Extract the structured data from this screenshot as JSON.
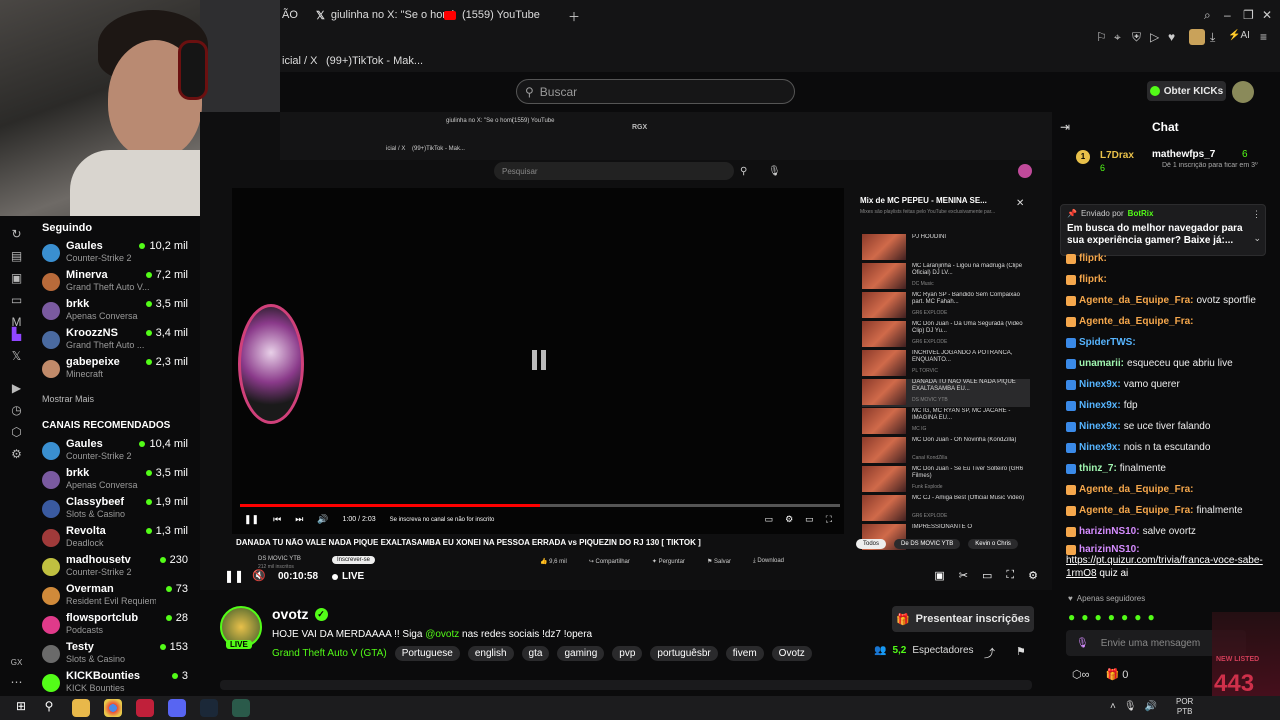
{
  "browser": {
    "tabs": [
      "ÃO",
      "giulinha no X: \"Se o homi",
      "(1559) YouTube"
    ],
    "tabs_row2": [
      "icial / X",
      "(99+)TikTok - Mak..."
    ],
    "search_placeholder": "Buscar",
    "kick_button": "Obter KICKs"
  },
  "inner_browser": {
    "tabs": [
      "giulinha no X: \"Se o homi",
      "(1559) YouTube"
    ],
    "tabs_row2": [
      "icial / X",
      "(99+)TikTok - Mak..."
    ],
    "yt_search_placeholder": "Pesquisar",
    "rgx_label": "RGX"
  },
  "youtube": {
    "mix_title": "Mix de MC PEPEU - MENINA SE...",
    "mix_subtitle": "Mixes são playlists feitas pelo YouTube exclusivamente par...",
    "playlist": [
      {
        "title": "PJ HOUDINI",
        "sub": "",
        "dur": ""
      },
      {
        "title": "MC Laranjinha - Ligou na madruga (Clipe Oficial) DJ LV...",
        "sub": "DC Music",
        "dur": "1:33"
      },
      {
        "title": "MC Ryan SP - Bandido Sem Compaixão part. MC Fahah...",
        "sub": "GR6 EXPLODE",
        "dur": "3:09"
      },
      {
        "title": "MC Don Juan - Da Uma Segurada (Video Clip) DJ Yu...",
        "sub": "GR6 EXPLODE",
        "dur": "2:38"
      },
      {
        "title": "INCRIVEL JOGANDO A POTRANCA, ENQUANTO...",
        "sub": "PL TORVIC",
        "dur": "1:47"
      },
      {
        "title": "DANADA TU NÃO VALE NADA PIQUE EXALTASAMBA EU...",
        "sub": "DS MOVIC YTB",
        "dur": "2:24"
      },
      {
        "title": "MC IG, MC RYAN SP, MC JACARÉ - IMAGINA EU...",
        "sub": "MC IG",
        "dur": "2:53"
      },
      {
        "title": "MC Don Juan - Ôh Novinha (KondZilla)",
        "sub": "Canal KondZilla",
        "dur": "2:55"
      },
      {
        "title": "MC Don Juan - Se Eu Tiver Solteiro (GR6 Filmes)",
        "sub": "Funk Explode",
        "dur": "3:06"
      },
      {
        "title": "MC CJ - Amiga Best (Official Music Video)",
        "sub": "GR6 EXPLODE",
        "dur": "2:20"
      },
      {
        "title": "IMPRESSIONANTE O",
        "sub": "",
        "dur": ""
      }
    ],
    "time": "1:00 / 2:03",
    "subscribe_hint": "Se inscreva no canal se não for inscrito",
    "video_title": "DANADA TU NÃO VALE NADA PIQUE EXALTASAMBA EU XONEI NA PESSOA ERRADA vs PIQUEZIN DO RJ 130 [ TIKTOK ]",
    "channel": "DS MOVIC YTB",
    "channel_subs": "212 mil inscritos",
    "subscribe_btn": "Inscrever-se",
    "likes": "9,6 mil",
    "share": "Compartilhar",
    "ask": "Perguntar",
    "save": "Salvar",
    "download": "Download",
    "chips": [
      "Todos",
      "De DS MOVIC YTB",
      "Kevin o Chris"
    ]
  },
  "player": {
    "elapsed": "00:10:58",
    "live": "LIVE"
  },
  "sidebar": {
    "following_title": "Seguindo",
    "following": [
      {
        "name": "Gaules",
        "game": "Counter-Strike 2",
        "viewers": "10,2 mil",
        "color": "#3a8fd0"
      },
      {
        "name": "Minerva",
        "game": "Grand Theft Auto V...",
        "viewers": "7,2 mil",
        "color": "#b86a3a"
      },
      {
        "name": "brkk",
        "game": "Apenas Conversa",
        "viewers": "3,5 mil",
        "color": "#7a5aa0"
      },
      {
        "name": "KroozzNS",
        "game": "Grand Theft Auto ...",
        "viewers": "3,4 mil",
        "color": "#4a6aa0"
      },
      {
        "name": "gabepeixe",
        "game": "Minecraft",
        "viewers": "2,3 mil",
        "color": "#c08a6a"
      }
    ],
    "show_more": "Mostrar Mais",
    "recommended_title": "CANAIS RECOMENDADOS",
    "recommended": [
      {
        "name": "Gaules",
        "game": "Counter-Strike 2",
        "viewers": "10,4 mil",
        "color": "#3a8fd0"
      },
      {
        "name": "brkk",
        "game": "Apenas Conversa",
        "viewers": "3,5 mil",
        "color": "#7a5aa0"
      },
      {
        "name": "Classybeef",
        "game": "Slots & Casino",
        "viewers": "1,9 mil",
        "color": "#3a5aa0"
      },
      {
        "name": "Revolta",
        "game": "Deadlock",
        "viewers": "1,3 mil",
        "color": "#a03a3a"
      },
      {
        "name": "madhousetv",
        "game": "Counter-Strike 2",
        "viewers": "230",
        "color": "#c0c040"
      },
      {
        "name": "Overman",
        "game": "Resident Evil Requiem",
        "viewers": "73",
        "color": "#d08a3a"
      },
      {
        "name": "flowsportclub",
        "game": "Podcasts",
        "viewers": "28",
        "color": "#e03a8a"
      },
      {
        "name": "Testy",
        "game": "Slots & Casino",
        "viewers": "153",
        "color": "#6a6a6a"
      },
      {
        "name": "KICKBounties",
        "game": "KICK Bounties",
        "viewers": "3",
        "color": "#53fc18"
      }
    ]
  },
  "stream": {
    "channel_name": "ovotz",
    "title": "HOJE VAI DA MERDAAAA !! Siga",
    "title_mention": "@ovotz",
    "title_rest": "nas redes sociais !dz7 !opera",
    "category": "Grand Theft Auto V (GTA)",
    "tags": [
      "Portuguese",
      "english",
      "gta",
      "gaming",
      "pvp",
      "portuguêsbr",
      "fivem",
      "Ovotz"
    ],
    "gift_button": "Presentear inscrições",
    "viewers": "5,2",
    "viewers_label": "Espectadores",
    "live_badge": "LIVE"
  },
  "chat": {
    "title": "Chat",
    "top_gifter": {
      "name": "L7Drax",
      "count": "6"
    },
    "top_gifter2": {
      "name": "mathewfps_7",
      "count": "6",
      "note": "Dê 1 inscrição para ficar em 3º"
    },
    "pinned_by": "Enviado por",
    "pinned_user": "BotRix",
    "pinned_text": "Em busca do melhor navegador para sua experiência gamer? Baixe já:...",
    "messages": [
      {
        "user": "fliprk:",
        "text": "",
        "cls": "u-orange"
      },
      {
        "user": "fliprk:",
        "text": "",
        "cls": "u-orange"
      },
      {
        "user": "Agente_da_Equipe_Fra:",
        "text": "ovotz sportfie",
        "cls": "u-orange"
      },
      {
        "user": "Agente_da_Equipe_Fra:",
        "text": "",
        "cls": "u-orange"
      },
      {
        "user": "SpiderTWS:",
        "text": "",
        "cls": "u-blue"
      },
      {
        "user": "unamarii:",
        "text": "esqueceu que abriu live",
        "cls": "u-green"
      },
      {
        "user": "Ninex9x:",
        "text": "vamo querer",
        "cls": "u-blue"
      },
      {
        "user": "Ninex9x:",
        "text": "fdp",
        "cls": "u-blue"
      },
      {
        "user": "Ninex9x:",
        "text": "se uce tiver falando",
        "cls": "u-blue"
      },
      {
        "user": "Ninex9x:",
        "text": "nois n ta escutando",
        "cls": "u-blue"
      },
      {
        "user": "thinz_7:",
        "text": "finalmente",
        "cls": "u-green"
      },
      {
        "user": "Agente_da_Equipe_Fra:",
        "text": "",
        "cls": "u-orange"
      },
      {
        "user": "Agente_da_Equipe_Fra:",
        "text": "finalmente",
        "cls": "u-orange"
      },
      {
        "user": "harizinNS10:",
        "text": "salve ovortz",
        "cls": "u-purple"
      },
      {
        "user": "harizinNS10:",
        "text": "",
        "cls": "u-purple"
      }
    ],
    "link": "https://pt.quizur.com/trivia/franca-voce-sabe-1rmO8",
    "link_tail": "quiz ai",
    "followers_only": "Apenas seguidores",
    "input_placeholder": "Envie uma mensagem",
    "points": "0",
    "overlay_count": "443",
    "overlay_label": "NEW LISTED"
  },
  "taskbar": {
    "lang": "POR",
    "lang2": "PTB"
  },
  "colors": {
    "kick_green": "#53fc18",
    "youtube_red": "#ff0000"
  }
}
